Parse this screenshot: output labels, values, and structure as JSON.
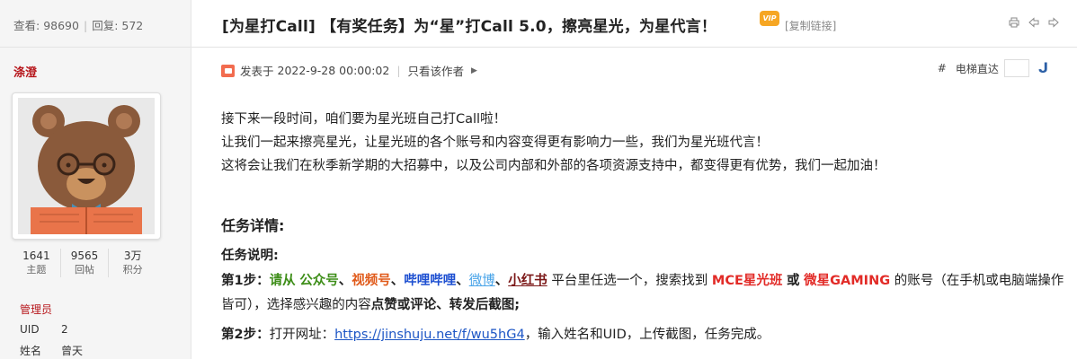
{
  "sidebar": {
    "views_label": "查看:",
    "views": "98690",
    "replies_label": "回复:",
    "replies": "572",
    "author": "涤澄",
    "stats": [
      {
        "num": "1641",
        "label": "主题"
      },
      {
        "num": "9565",
        "label": "回帖"
      },
      {
        "num": "3万",
        "label": "积分"
      }
    ],
    "role": "管理员",
    "info": [
      {
        "key": "UID",
        "value": "2"
      },
      {
        "key": "姓名",
        "value": "曾天"
      }
    ]
  },
  "post": {
    "title": "[为星打Call] 【有奖任务】为“星”打Call 5.0，擦亮星光，为星代言！",
    "vip_badge": "VIP",
    "copy_link": "[复制链接]",
    "posted_label": "发表于",
    "posted_time": "2022-9-28 00:00:02",
    "author_only": "只看该作者",
    "jump_hash": "#",
    "jump_label": "电梯直达"
  },
  "content": {
    "intro": [
      "接下来一段时间，咱们要为星光班自己打Call啦！",
      "让我们一起来擦亮星光，让星光班的各个账号和内容变得更有影响力一些，我们为星光班代言！",
      "这将会让我们在秋季新学期的大招募中，以及公司内部和外部的各项资源支持中，都变得更有优势，我们一起加油！"
    ],
    "task_title": "任务详情:",
    "task_sub": "任务说明:",
    "step1": {
      "label": "第1步：",
      "t1": "请从",
      "wechat": "公众号",
      "sep1": "、",
      "channels": "视频号",
      "sep2": "、",
      "bilibili": "哔哩哔哩",
      "sep3": "、",
      "weibo": "微博",
      "sep4": "、",
      "xhs": "小红书",
      "t2": "平台里任选一个，搜索找到",
      "mce": "MCE星光班",
      "or": "或",
      "gaming": "微星GAMING",
      "t3": "的账号（在手机或电脑端操作皆可），选择感兴趣的内容",
      "action": "点赞或评论、转发后截图;"
    },
    "step2": {
      "label": "第2步：",
      "t1": "打开网址：",
      "url": "https://jinshuju.net/f/wu5hG4",
      "t2": "，输入姓名和UID，上传截图，任务完成。"
    }
  },
  "colors": {
    "author_red": "#b7171c",
    "green": "#3e8e19",
    "orange": "#e05a1a",
    "blue": "#1d4fd1",
    "light_blue": "#47a3e8",
    "brown": "#7b1717",
    "red": "#e22b27"
  },
  "icons": [
    "print-icon",
    "prev-arrow-icon",
    "next-arrow-icon",
    "post-icon",
    "go-icon"
  ]
}
